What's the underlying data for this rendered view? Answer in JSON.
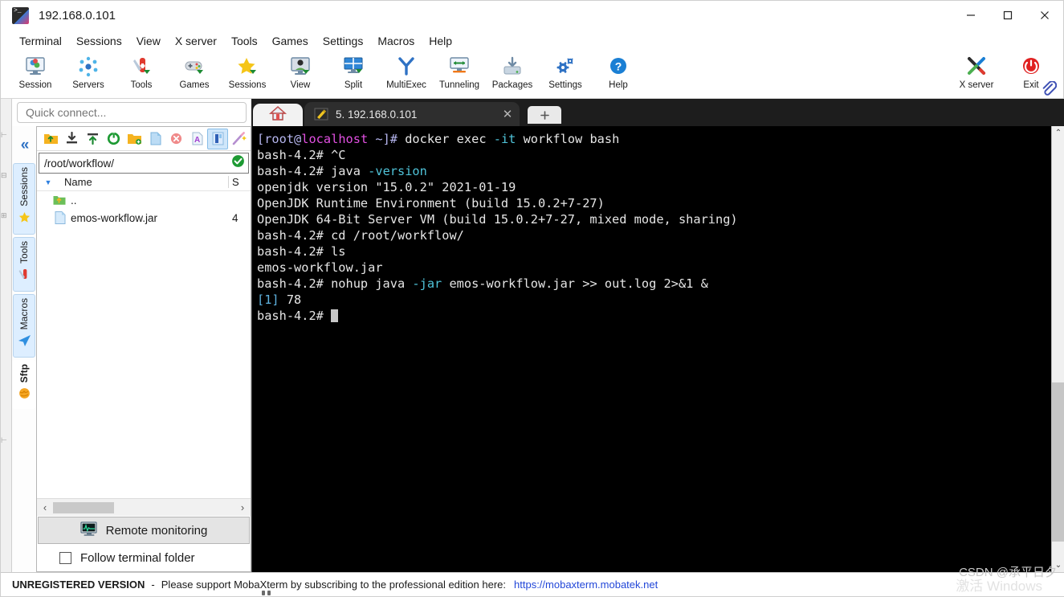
{
  "window": {
    "title": "192.168.0.101",
    "app_icon": "mobaxterm-icon",
    "minimize": "minimize-icon",
    "maximize": "maximize-icon",
    "close": "close-icon"
  },
  "menubar": {
    "items": [
      {
        "label": "Terminal"
      },
      {
        "label": "Sessions"
      },
      {
        "label": "View"
      },
      {
        "label": "X server"
      },
      {
        "label": "Tools"
      },
      {
        "label": "Games"
      },
      {
        "label": "Settings"
      },
      {
        "label": "Macros"
      },
      {
        "label": "Help"
      }
    ]
  },
  "toolbar": {
    "items": [
      {
        "label": "Session",
        "icon": "session-icon"
      },
      {
        "label": "Servers",
        "icon": "servers-icon"
      },
      {
        "label": "Tools",
        "icon": "tools-icon"
      },
      {
        "label": "Games",
        "icon": "games-icon"
      },
      {
        "label": "Sessions",
        "icon": "sessions-star-icon"
      },
      {
        "label": "View",
        "icon": "view-icon"
      },
      {
        "label": "Split",
        "icon": "split-icon"
      },
      {
        "label": "MultiExec",
        "icon": "multiexec-icon"
      },
      {
        "label": "Tunneling",
        "icon": "tunneling-icon"
      },
      {
        "label": "Packages",
        "icon": "packages-icon"
      },
      {
        "label": "Settings",
        "icon": "settings-gear-icon"
      },
      {
        "label": "Help",
        "icon": "help-icon"
      }
    ],
    "right_items": [
      {
        "label": "X server",
        "icon": "x-server-icon"
      },
      {
        "label": "Exit",
        "icon": "exit-power-icon"
      }
    ]
  },
  "sidebar": {
    "quick_connect_placeholder": "Quick connect...",
    "collapse_label": "«",
    "vertical_tabs": [
      {
        "label": "Sessions",
        "icon": "star-icon",
        "active": true
      },
      {
        "label": "Tools",
        "icon": "tools-icon",
        "active": true
      },
      {
        "label": "Macros",
        "icon": "macros-icon",
        "active": true
      },
      {
        "label": "Sftp",
        "icon": "sftp-globe-icon",
        "active": false
      }
    ],
    "sftp_toolbar": [
      {
        "icon": "go-up-folder-icon",
        "active": false
      },
      {
        "icon": "download-icon",
        "active": false
      },
      {
        "icon": "upload-icon",
        "active": false
      },
      {
        "icon": "refresh-icon",
        "active": false
      },
      {
        "icon": "new-folder-icon",
        "active": false
      },
      {
        "icon": "new-file-icon",
        "active": false
      },
      {
        "icon": "delete-icon",
        "active": false
      },
      {
        "icon": "text-mode-icon",
        "active": false
      },
      {
        "icon": "binary-mode-icon",
        "active": true
      },
      {
        "icon": "edit-wand-icon",
        "active": false
      }
    ],
    "path": "/root/workflow/",
    "path_ok_icon": "check-circle-icon",
    "file_table": {
      "sort_icon": "sort-desc-icon",
      "columns": [
        "Name",
        "S"
      ],
      "rows": [
        {
          "icon": "parent-folder-icon",
          "name": "..",
          "size": ""
        },
        {
          "icon": "file-icon",
          "name": "emos-workflow.jar",
          "size": "4"
        }
      ]
    },
    "hscroll": {
      "left_arrow": "‹",
      "right_arrow": "›"
    },
    "remote_monitoring": {
      "label": "Remote monitoring",
      "icon": "monitor-graph-icon"
    },
    "follow_terminal_folder": {
      "label": "Follow terminal folder",
      "checked": false
    }
  },
  "tabs": {
    "home_icon": "home-icon",
    "session_tab": {
      "icon": "ssh-key-icon",
      "label": "5. 192.168.0.101",
      "close": "✕"
    },
    "add_tab_label": "➕",
    "clip_icon": "paperclip-icon"
  },
  "terminal": {
    "lines": [
      {
        "segments": [
          {
            "text": "[root@",
            "cls": "c-prompt"
          },
          {
            "text": "localhost",
            "cls": "c-host"
          },
          {
            "text": " ~]# ",
            "cls": "c-prompt"
          },
          {
            "text": "docker exec ",
            "cls": "c-white"
          },
          {
            "text": "-it",
            "cls": "c-cyan"
          },
          {
            "text": " workflow bash",
            "cls": "c-white"
          }
        ]
      },
      {
        "segments": [
          {
            "text": "bash-4.2# ^C",
            "cls": "c-white"
          }
        ]
      },
      {
        "segments": [
          {
            "text": "bash-4.2# java ",
            "cls": "c-white"
          },
          {
            "text": "-version",
            "cls": "c-cyan"
          }
        ]
      },
      {
        "segments": [
          {
            "text": "openjdk version \"15.0.2\" 2021-01-19",
            "cls": "c-white"
          }
        ]
      },
      {
        "segments": [
          {
            "text": "OpenJDK Runtime Environment (build 15.0.2+7-27)",
            "cls": "c-white"
          }
        ]
      },
      {
        "segments": [
          {
            "text": "OpenJDK 64-Bit Server VM (build 15.0.2+7-27, mixed mode, sharing)",
            "cls": "c-white"
          }
        ]
      },
      {
        "segments": [
          {
            "text": "bash-4.2# cd /root/workflow/",
            "cls": "c-white"
          }
        ]
      },
      {
        "segments": [
          {
            "text": "bash-4.2# ls",
            "cls": "c-white"
          }
        ]
      },
      {
        "segments": [
          {
            "text": "emos-workflow.jar",
            "cls": "c-white"
          }
        ]
      },
      {
        "segments": [
          {
            "text": "bash-4.2# nohup java ",
            "cls": "c-white"
          },
          {
            "text": "-jar",
            "cls": "c-cyan"
          },
          {
            "text": " emos-workflow.jar >> out.log 2>&1 &",
            "cls": "c-white"
          }
        ]
      },
      {
        "segments": [
          {
            "text": "[1]",
            "cls": "c-blue"
          },
          {
            "text": " 78",
            "cls": "c-white"
          }
        ]
      },
      {
        "segments": [
          {
            "text": "bash-4.2# ",
            "cls": "c-white"
          },
          {
            "text": "",
            "cls": "cursor-slot"
          }
        ]
      }
    ],
    "scroll_up_arrow": "⌃",
    "scroll_down_arrow": "⌄"
  },
  "statusbar": {
    "unregistered": "UNREGISTERED VERSION",
    "dash": "-",
    "message": "Please support MobaXterm by subscribing to the professional edition here:",
    "link": "https://mobaxterm.mobatek.net"
  },
  "watermarks": {
    "csdn": "CSDN @承平日夕",
    "activate": "激活 Windows"
  },
  "colors": {
    "accent_blue": "#2f72c4",
    "terminal_bg": "#000000",
    "terminal_fg": "#e6e6e6",
    "prompt_lavender": "#b6b6ef",
    "host_magenta": "#e250e2",
    "flag_cyan": "#4fc3d9",
    "link_blue": "#2146d8",
    "tabbar_bg": "#1d1d1d"
  }
}
